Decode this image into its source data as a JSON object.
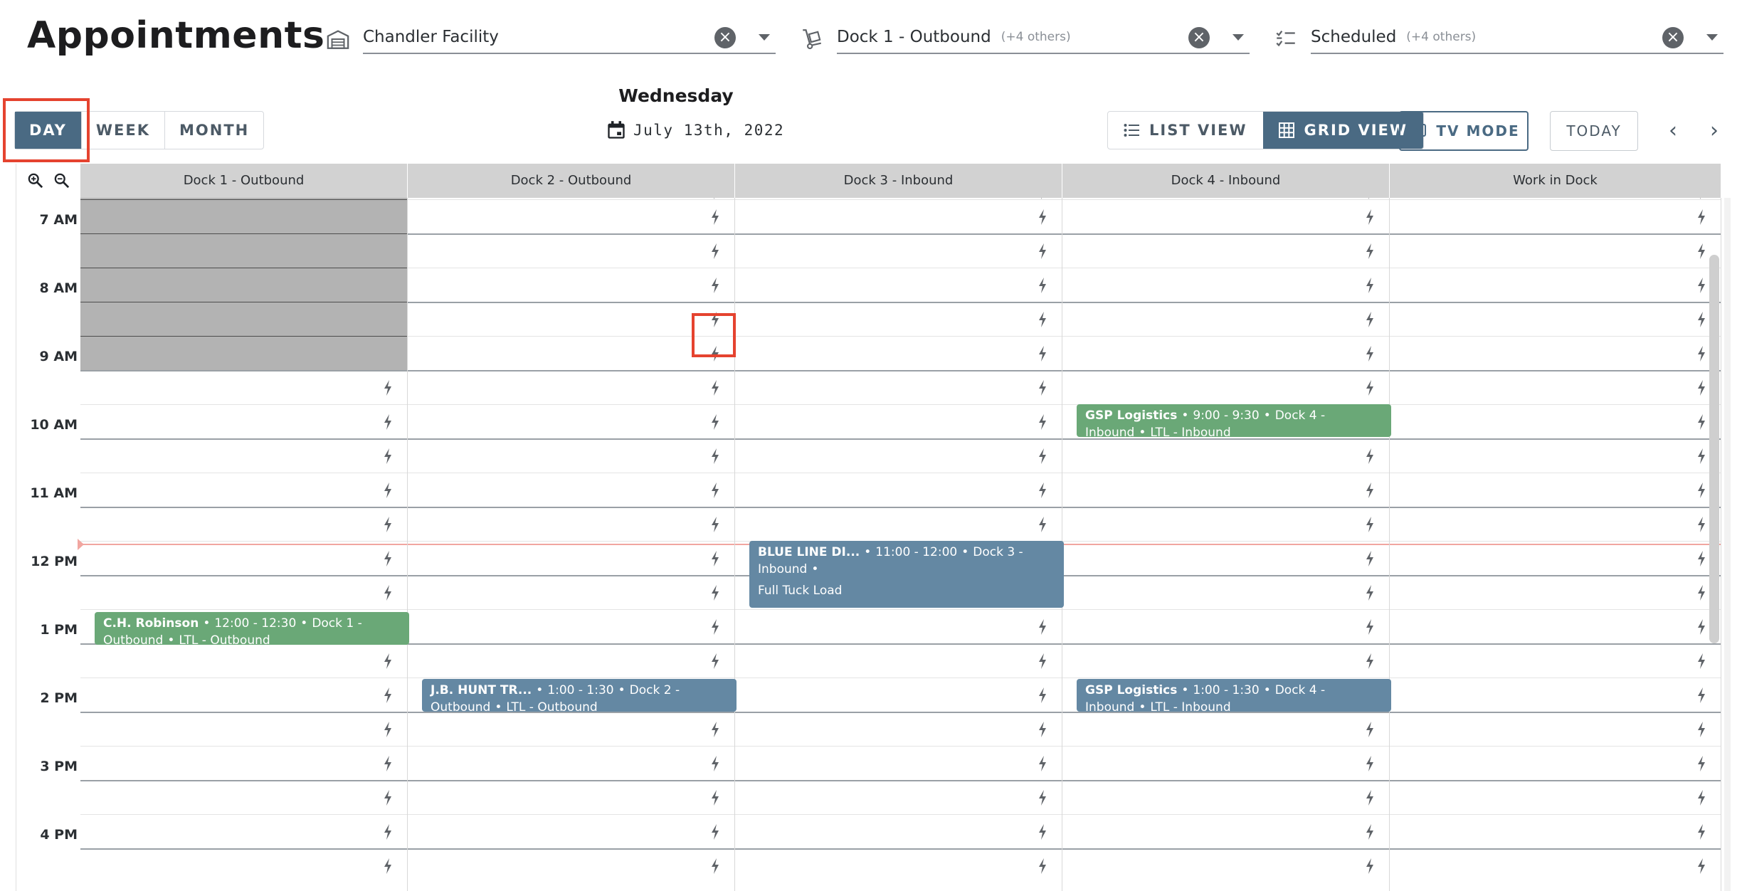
{
  "header": {
    "title": "Appointments",
    "filters": [
      {
        "value": "Chandler Facility",
        "extra": "",
        "icon": "warehouse-icon"
      },
      {
        "value": "Dock 1 - Outbound",
        "extra": "(+4 others)",
        "icon": "dolly-icon"
      },
      {
        "value": "Scheduled",
        "extra": "(+4 others)",
        "icon": "checklist-icon"
      }
    ],
    "clear_symbol": "×"
  },
  "toolbar": {
    "range": [
      {
        "label": "DAY",
        "active": true
      },
      {
        "label": "WEEK",
        "active": false
      },
      {
        "label": "MONTH",
        "active": false
      }
    ],
    "day_name": "Wednesday",
    "date": "July 13th, 2022",
    "list_view_label": "LIST VIEW",
    "grid_view_label": "GRID VIEW",
    "tv_mode_label": "TV MODE",
    "today_label": "TODAY",
    "prev_symbol": "‹",
    "next_symbol": "›"
  },
  "calendar": {
    "columns": [
      "Dock 1 - Outbound",
      "Dock 2 - Outbound",
      "Dock 3 - Inbound",
      "Dock 4 - Inbound",
      "Work in Dock"
    ],
    "times": [
      "7 AM",
      "8 AM",
      "9 AM",
      "10 AM",
      "11 AM",
      "12 PM",
      "1 PM",
      "2 PM",
      "3 PM",
      "4 PM"
    ],
    "appointments": [
      {
        "carrier": "GSP Logistics",
        "time": "9:00 - 9:30",
        "dock": "Dock 4 - Inbound",
        "type": "LTL - Inbound",
        "color": "#6aa877"
      },
      {
        "carrier": "BLUE LINE DI...",
        "time": "11:00 - 12:00",
        "dock": "Dock 3 - Inbound",
        "type": "Full Tuck Load",
        "color": "#6488a3"
      },
      {
        "carrier": "C.H. Robinson",
        "time": "12:00 - 12:30",
        "dock": "Dock 1 - Outbound",
        "type": "LTL - Outbound",
        "color": "#6aa877"
      },
      {
        "carrier": "J.B. HUNT TR...",
        "time": "1:00 - 1:30",
        "dock": "Dock 2 - Outbound",
        "type": "LTL - Outbound",
        "color": "#6488a3"
      },
      {
        "carrier": "GSP Logistics",
        "time": "1:00 - 1:30",
        "dock": "Dock 4 - Inbound",
        "type": "LTL - Inbound",
        "color": "#6488a3"
      }
    ],
    "bullet": "•"
  },
  "colors": {
    "accent": "#4a6a83",
    "highlight": "#e5432f",
    "now_line": "#f1a6a0",
    "blocked": "#b3b3b3"
  }
}
